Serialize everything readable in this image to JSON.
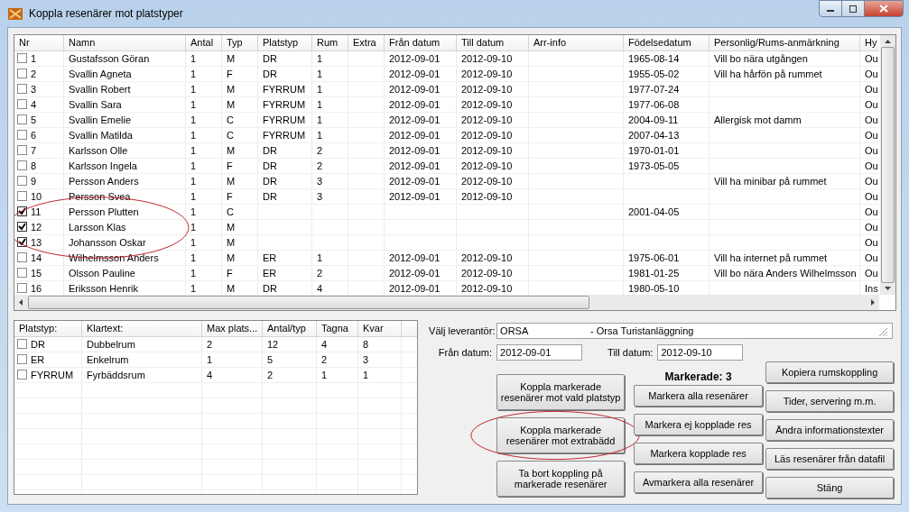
{
  "window": {
    "title": "Koppla resenärer mot platstyper"
  },
  "travelers": {
    "columns": [
      "Nr",
      "Namn",
      "Antal",
      "Typ",
      "Platstyp",
      "Rum",
      "Extra",
      "Från datum",
      "Till datum",
      "Arr-info",
      "Födelsedatum",
      "Personlig/Rums-anmärkning",
      "Hy"
    ],
    "rows": [
      {
        "checked": false,
        "circled": false,
        "cells": [
          "1",
          "Gustafsson Göran",
          "1",
          "M",
          "DR",
          "1",
          null,
          "2012-09-01",
          "2012-09-10",
          null,
          "1965-08-14",
          "Vill bo nära utgången",
          "Ou"
        ]
      },
      {
        "checked": false,
        "circled": false,
        "cells": [
          "2",
          "Svallin Agneta",
          "1",
          "F",
          "DR",
          "1",
          null,
          "2012-09-01",
          "2012-09-10",
          null,
          "1955-05-02",
          "Vill ha hårfön på rummet",
          "Ou"
        ]
      },
      {
        "checked": false,
        "circled": false,
        "cells": [
          "3",
          "Svallin Robert",
          "1",
          "M",
          "FYRRUM",
          "1",
          null,
          "2012-09-01",
          "2012-09-10",
          null,
          "1977-07-24",
          null,
          "Ou"
        ]
      },
      {
        "checked": false,
        "circled": false,
        "cells": [
          "4",
          "Svallin Sara",
          "1",
          "M",
          "FYRRUM",
          "1",
          null,
          "2012-09-01",
          "2012-09-10",
          null,
          "1977-06-08",
          null,
          "Ou"
        ]
      },
      {
        "checked": false,
        "circled": false,
        "cells": [
          "5",
          "Svallin Emelie",
          "1",
          "C",
          "FYRRUM",
          "1",
          null,
          "2012-09-01",
          "2012-09-10",
          null,
          "2004-09-11",
          "Allergisk mot damm",
          "Ou"
        ]
      },
      {
        "checked": false,
        "circled": false,
        "cells": [
          "6",
          "Svallin Matilda",
          "1",
          "C",
          "FYRRUM",
          "1",
          null,
          "2012-09-01",
          "2012-09-10",
          null,
          "2007-04-13",
          null,
          "Ou"
        ]
      },
      {
        "checked": false,
        "circled": false,
        "cells": [
          "7",
          "Karlsson Olle",
          "1",
          "M",
          "DR",
          "2",
          null,
          "2012-09-01",
          "2012-09-10",
          null,
          "1970-01-01",
          null,
          "Ou"
        ]
      },
      {
        "checked": false,
        "circled": false,
        "cells": [
          "8",
          "Karlsson Ingela",
          "1",
          "F",
          "DR",
          "2",
          null,
          "2012-09-01",
          "2012-09-10",
          null,
          "1973-05-05",
          null,
          "Ou"
        ]
      },
      {
        "checked": false,
        "circled": false,
        "cells": [
          "9",
          "Persson Anders",
          "1",
          "M",
          "DR",
          "3",
          null,
          "2012-09-01",
          "2012-09-10",
          null,
          null,
          "Vill ha minibar på rummet",
          "Ou"
        ]
      },
      {
        "checked": false,
        "circled": false,
        "cells": [
          "10",
          "Persson Svea",
          "1",
          "F",
          "DR",
          "3",
          null,
          "2012-09-01",
          "2012-09-10",
          null,
          null,
          null,
          "Ou"
        ]
      },
      {
        "checked": true,
        "circled": true,
        "cells": [
          "11",
          "Persson Plutten",
          "1",
          "C",
          null,
          null,
          null,
          null,
          null,
          null,
          "2001-04-05",
          null,
          "Ou"
        ]
      },
      {
        "checked": true,
        "circled": true,
        "cells": [
          "12",
          "Larsson Klas",
          "1",
          "M",
          null,
          null,
          null,
          null,
          null,
          null,
          null,
          null,
          "Ou"
        ]
      },
      {
        "checked": true,
        "circled": true,
        "cells": [
          "13",
          "Johansson Oskar",
          "1",
          "M",
          null,
          null,
          null,
          null,
          null,
          null,
          null,
          null,
          "Ou"
        ]
      },
      {
        "checked": false,
        "circled": false,
        "cells": [
          "14",
          "Wilhelmsson Anders",
          "1",
          "M",
          "ER",
          "1",
          null,
          "2012-09-01",
          "2012-09-10",
          null,
          "1975-06-01",
          "Vill ha internet på rummet",
          "Ou"
        ]
      },
      {
        "checked": false,
        "circled": false,
        "cells": [
          "15",
          "Olsson Pauline",
          "1",
          "F",
          "ER",
          "2",
          null,
          "2012-09-01",
          "2012-09-10",
          null,
          "1981-01-25",
          "Vill bo nära Anders Wilhelmsson",
          "Ou"
        ]
      },
      {
        "checked": false,
        "circled": false,
        "cells": [
          "16",
          "Eriksson Henrik",
          "1",
          "M",
          "DR",
          "4",
          null,
          "2012-09-01",
          "2012-09-10",
          null,
          "1980-05-10",
          null,
          "Ins"
        ]
      }
    ]
  },
  "room_types": {
    "columns": [
      "Platstyp:",
      "Klartext:",
      "Max plats...",
      "Antal/typ",
      "Tagna",
      "Kvar"
    ],
    "rows": [
      {
        "checked": false,
        "cells": [
          "DR",
          "Dubbelrum",
          "2",
          "12",
          "4",
          "8"
        ]
      },
      {
        "checked": false,
        "cells": [
          "ER",
          "Enkelrum",
          "1",
          "5",
          "2",
          "3"
        ]
      },
      {
        "checked": false,
        "cells": [
          "FYRRUM",
          "Fyrbäddsrum",
          "4",
          "2",
          "1",
          "1"
        ]
      }
    ]
  },
  "supplier": {
    "label": "Välj leverantör:",
    "code": "ORSA",
    "name": "- Orsa Turistanläggning"
  },
  "from_date": {
    "label": "Från datum:",
    "value": "2012-09-01"
  },
  "to_date": {
    "label": "Till datum:",
    "value": "2012-09-10"
  },
  "marked_count": "Markerade: 3",
  "buttons_left": [
    {
      "label": "Koppla markerade resenärer mot vald platstyp",
      "circled": false
    },
    {
      "label": "Koppla markerade resenärer mot extrabädd",
      "circled": true
    },
    {
      "label": "Ta bort koppling på markerade resenärer",
      "circled": false
    }
  ],
  "buttons_middle": [
    "Markera alla resenärer",
    "Markera ej kopplade res",
    "Markera kopplade res",
    "Avmarkera alla resenärer"
  ],
  "buttons_right": [
    "Kopiera rumskoppling",
    "Tider, servering m.m.",
    "Ändra informationstexter",
    "Läs resenärer från datafil",
    "Stäng"
  ]
}
